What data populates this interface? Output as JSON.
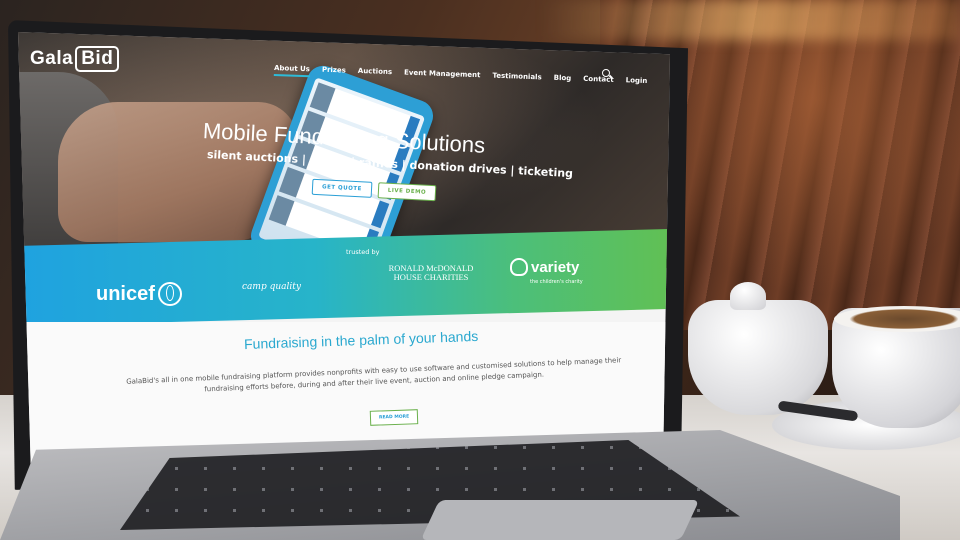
{
  "brand": {
    "gala": "Gala",
    "bid": "Bid"
  },
  "nav": {
    "items": [
      {
        "label": "About Us"
      },
      {
        "label": "Prizes"
      },
      {
        "label": "Auctions"
      },
      {
        "label": "Event Management"
      },
      {
        "label": "Testimonials"
      },
      {
        "label": "Blog"
      },
      {
        "label": "Contact"
      },
      {
        "label": "Login"
      }
    ],
    "search_icon": "search-icon"
  },
  "hero": {
    "title": "Mobile Fundraising Solutions",
    "subtitle": "silent auctions | prizes | raffles | donation drives | ticketing",
    "btn_quote": "GET QUOTE",
    "btn_demo": "LIVE DEMO"
  },
  "partners": {
    "trusted": "trusted by",
    "unicef": "unicef",
    "camp": "camp quality",
    "rmhc_line1": "RONALD McDONALD",
    "rmhc_line2": "HOUSE CHARITIES",
    "variety": "variety",
    "variety_sub": "the children's charity"
  },
  "content": {
    "title": "Fundraising in the palm of your hands",
    "body": "GalaBid's all in one mobile fundraising platform provides nonprofits with easy to use software and customised solutions to help manage their fundraising efforts before, during and after their live event, auction and online pledge campaign.",
    "read_more": "READ MORE"
  },
  "colors": {
    "accent_blue": "#2aa8cf",
    "accent_green": "#6ab04c"
  }
}
